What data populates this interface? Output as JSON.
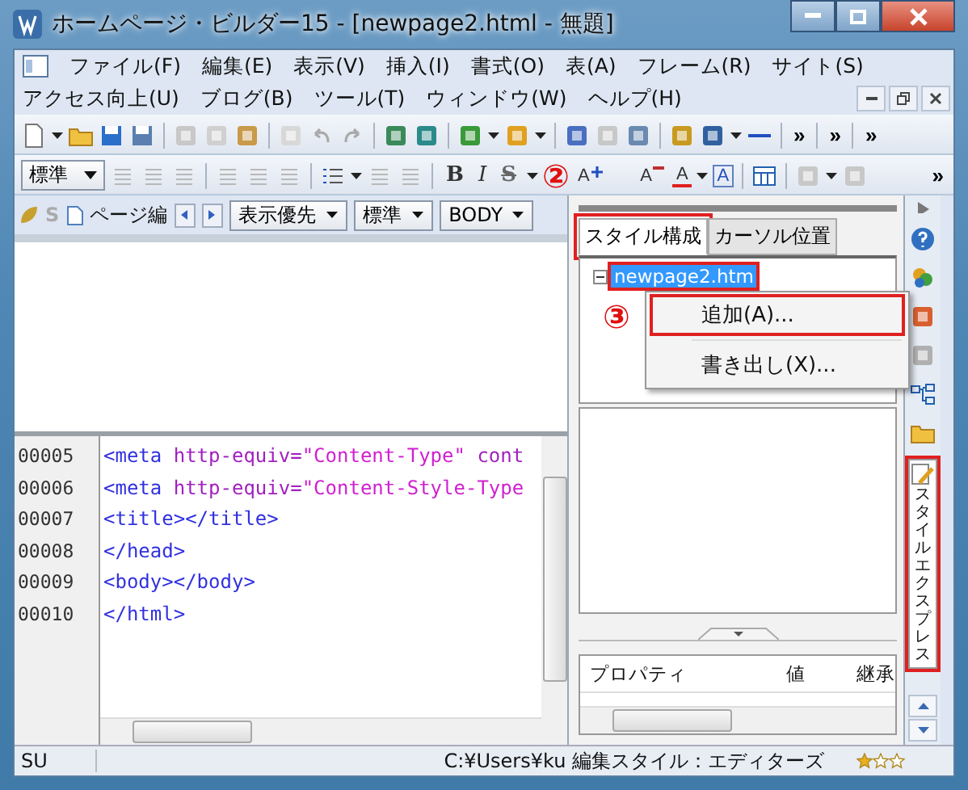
{
  "window": {
    "title": "ホームページ・ビルダー15 - [newpage2.html - 無題]"
  },
  "menu_rows": [
    [
      "ファイル(F)",
      "編集(E)",
      "表示(V)",
      "挿入(I)",
      "書式(O)",
      "表(A)",
      "フレーム(R)",
      "サイト(S)"
    ],
    [
      "アクセス向上(U)",
      "ブログ(B)",
      "ツール(T)",
      "ウィンドウ(W)",
      "ヘルプ(H)"
    ]
  ],
  "toolbar_1": {
    "overflow": [
      "»",
      "»",
      "»"
    ]
  },
  "toolbar_2": {
    "style_select": "標準",
    "format_buttons": [
      "B",
      "I",
      "S"
    ],
    "marker": "②",
    "font_buttons": [
      {
        "glyph": "A",
        "kind": "grow"
      },
      {
        "glyph": "A",
        "kind": "shrink"
      },
      {
        "glyph": "A",
        "kind": "color"
      },
      {
        "glyph": "A",
        "kind": "style"
      }
    ],
    "overflow": "»"
  },
  "page_bar": {
    "letter": "S",
    "label": "ページ編",
    "selects": [
      "表示優先",
      "標準",
      "BODY"
    ]
  },
  "code_editor": {
    "lines": [
      {
        "number": "00005",
        "segments": [
          {
            "kind": "tag",
            "text": "<meta"
          },
          {
            "kind": "attr",
            "text": " http-equiv="
          },
          {
            "kind": "value",
            "text": "\"Content-Type\""
          },
          {
            "kind": "attr",
            "text": " cont"
          }
        ]
      },
      {
        "number": "00006",
        "segments": [
          {
            "kind": "tag",
            "text": "<meta"
          },
          {
            "kind": "attr",
            "text": " http-equiv="
          },
          {
            "kind": "value",
            "text": "\"Content-Style-Type"
          }
        ]
      },
      {
        "number": "00007",
        "segments": [
          {
            "kind": "tag",
            "text": "<title></title>"
          }
        ]
      },
      {
        "number": "00008",
        "segments": [
          {
            "kind": "tag",
            "text": "</head>"
          }
        ]
      },
      {
        "number": "00009",
        "segments": [
          {
            "kind": "tag",
            "text": "<body></body>"
          }
        ]
      },
      {
        "number": "00010",
        "segments": [
          {
            "kind": "tag",
            "text": "</html>"
          }
        ]
      }
    ]
  },
  "style_panel": {
    "tabs": [
      {
        "label": "スタイル構成",
        "selected": true,
        "highlighted": true
      },
      {
        "label": "カーソル位置",
        "selected": false,
        "highlighted": false
      }
    ],
    "tree": [
      {
        "label": "newpage2.htm",
        "expanded": true,
        "selected": true,
        "highlighted": true
      }
    ],
    "context_menu": {
      "marker": "③",
      "items": [
        {
          "label": "追加(A)...",
          "highlighted": true
        },
        {
          "label": "書き出し(X)...",
          "highlighted": false
        }
      ]
    },
    "properties": {
      "columns": [
        "プロパティ",
        "値",
        "継承"
      ]
    }
  },
  "side_dock": {
    "tab": {
      "label": "スタイルエクスプレス",
      "highlighted": true
    }
  },
  "status_bar": {
    "cells": [
      "SU",
      "C:¥Users¥ku 編集スタイル：エディターズ"
    ],
    "stars": 1
  }
}
